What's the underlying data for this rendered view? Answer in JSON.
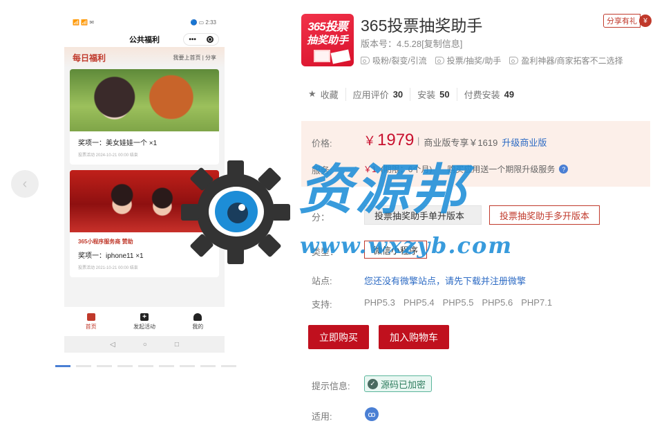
{
  "preview": {
    "nav_prev_icon": "chevron-left-icon",
    "phone": {
      "status_signal": "📶 📶 ✉",
      "status_time": "🔵 ▭ 2:33",
      "header_title": "公共福利",
      "capsule_more": "•••",
      "section_title": "每日福利",
      "section_links": "我要上首页  |  分享",
      "cards": [
        {
          "sponsor": "",
          "prize": "奖项一：美女娃娃一个 ×1",
          "meta": "投票活动 2024-10-21 00:00 结束"
        },
        {
          "sponsor": "365小程序服务商  赞助",
          "prize": "奖项一：iphone11 ×1",
          "meta": "投票活动 2021-10-21 00:00 结束"
        }
      ],
      "tabs": [
        {
          "label": "首页",
          "icon": "gift-icon",
          "active": true
        },
        {
          "label": "发起活动",
          "icon": "plus-icon",
          "active": false
        },
        {
          "label": "我的",
          "icon": "user-icon",
          "active": false
        }
      ],
      "sysnav": [
        "◁",
        "○",
        "□"
      ]
    },
    "pager": {
      "count": 9,
      "active_index": 0
    }
  },
  "app": {
    "logo_line1": "365投票",
    "logo_line2": "抽奖助手",
    "title": "365投票抽奖助手",
    "version": "版本号：4.5.28[复制信息]",
    "tags": [
      "吸粉/裂变/引流",
      "投票/抽奖/助手",
      "盈利神器/商家拓客不二选择"
    ],
    "share_label": "分享有礼",
    "share_icon": "¥"
  },
  "stats": {
    "favorite": "收藏",
    "rating_label": "应用评价",
    "rating_value": "30",
    "install_label": "安装",
    "install_value": "50",
    "paid_label": "付费安装",
    "paid_value": "49"
  },
  "pricing": {
    "price_label": "价格:",
    "currency": "￥",
    "price": "1979",
    "sep": "|",
    "business_text": "商业版专享￥1619",
    "upgrade_link": "升级商业版",
    "service_label": "服务:",
    "service_amount": "￥1",
    "service_period": "(期限：6个月)",
    "service_note": "购买应用送一个期限升级服务",
    "help_icon": "?"
  },
  "fields": {
    "version_label": "分：",
    "version_options": [
      "投票抽奖助手单开版本",
      "投票抽奖助手多开版本"
    ],
    "type_label": "类型：",
    "type_value": "微信小程序",
    "site_label": "站点:",
    "site_text": "您还没有微擎站点，请先下载并注册微擎",
    "support_label": "支持:",
    "php_versions": [
      "PHP5.3",
      "PHP5.4",
      "PHP5.5",
      "PHP5.6",
      "PHP7.1"
    ],
    "buy_button": "立即购买",
    "cart_button": "加入购物车",
    "tips_label": "提示信息:",
    "encrypted_badge": "源码已加密",
    "apply_label": "适用:"
  },
  "watermark": {
    "text": "资源邦",
    "url": "www.wxzyb.com"
  },
  "colors": {
    "brand_red": "#c0101e",
    "link_blue": "#2d6bc4",
    "price_bg": "#fcefe9",
    "watermark_blue": "#1d8dd7"
  }
}
